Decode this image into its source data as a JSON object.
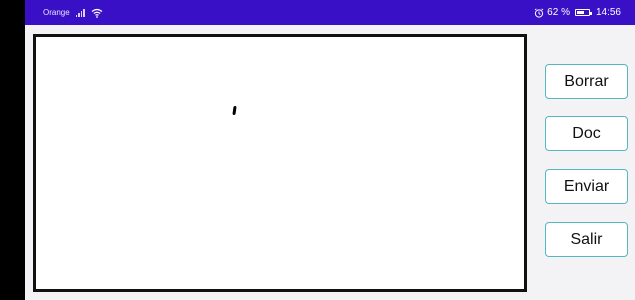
{
  "status_bar": {
    "carrier": "Orange",
    "icons": [
      "signal-icon",
      "wifi-icon",
      "alarm-icon",
      "battery-icon"
    ],
    "battery_level": 0.62,
    "battery_text": "62 %",
    "time": "14:56",
    "background_color": "#3a10c6"
  },
  "drawing_area": {
    "border_color": "#111111",
    "background_color": "#ffffff"
  },
  "buttons": {
    "borrar": "Borrar",
    "doc": "Doc",
    "enviar": "Enviar",
    "salir": "Salir",
    "border_color": "#56b6c2"
  }
}
